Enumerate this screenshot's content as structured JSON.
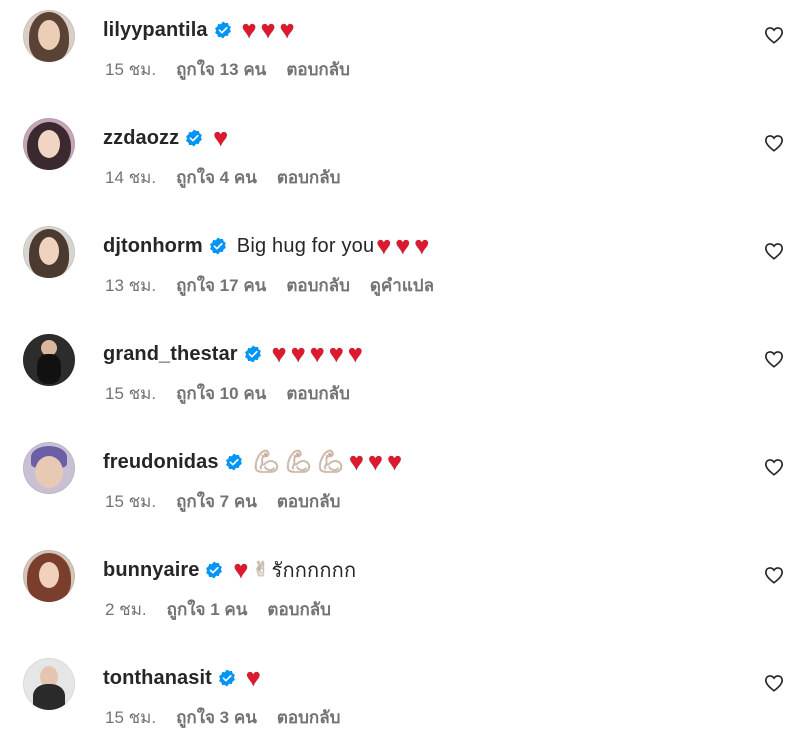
{
  "comments": [
    {
      "username": "lilyypantila",
      "text": "",
      "hearts": 3,
      "time": "15 ชม.",
      "likes": "ถูกใจ 13 คน",
      "reply": "ตอบกลับ"
    },
    {
      "username": "zzdaozz",
      "text": "",
      "hearts": 1,
      "time": "14 ชม.",
      "likes": "ถูกใจ 4 คน",
      "reply": "ตอบกลับ"
    },
    {
      "username": "djtonhorm",
      "text": "Big hug for you",
      "hearts": 3,
      "time": "13 ชม.",
      "likes": "ถูกใจ 17 คน",
      "reply": "ตอบกลับ",
      "translate": "ดูคำแปล"
    },
    {
      "username": "grand_thestar",
      "text": "",
      "hearts": 5,
      "time": "15 ชม.",
      "likes": "ถูกใจ 10 คน",
      "reply": "ตอบกลับ"
    },
    {
      "username": "freudonidas",
      "text": "",
      "muscles": 3,
      "hearts": 3,
      "time": "15 ชม.",
      "likes": "ถูกใจ 7 คน",
      "reply": "ตอบกลับ"
    },
    {
      "username": "bunnyaire",
      "text": "รักกกกกก",
      "hearts": 1,
      "time": "2 ชม.",
      "likes": "ถูกใจ 1 คน",
      "reply": "ตอบกลับ"
    },
    {
      "username": "tonthanasit",
      "text": "",
      "hearts": 1,
      "time": "15 ชม.",
      "likes": "ถูกใจ 3 คน",
      "reply": "ตอบกลับ"
    }
  ],
  "colors": {
    "verified_badge": "#0095f6",
    "heart": "#e0182d",
    "meta_text": "#737373",
    "username_text": "#262626"
  },
  "icons": {
    "verified": "verified-badge-icon",
    "like": "heart-outline-icon",
    "heart_emoji": "red-heart-emoji",
    "muscle_emoji": "flexed-biceps-emoji",
    "hand_emoji": "victory-hand-emoji"
  }
}
